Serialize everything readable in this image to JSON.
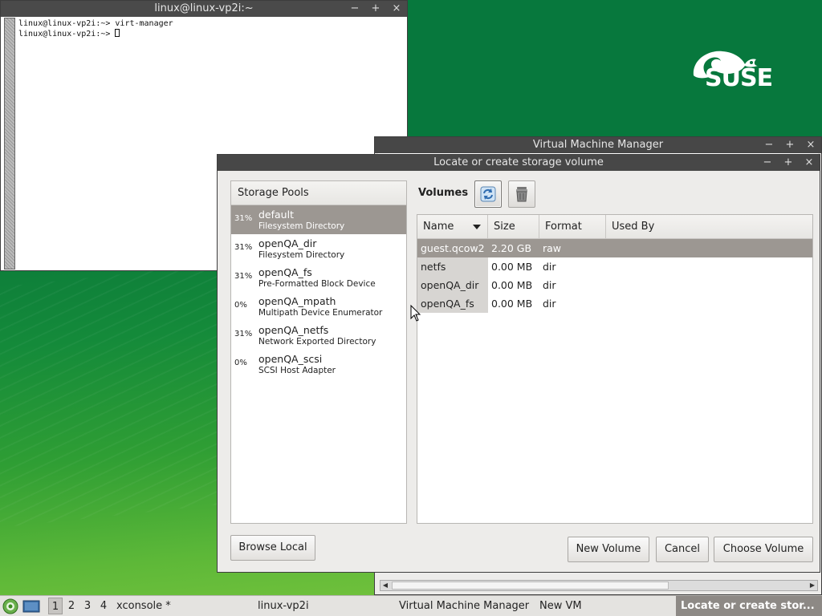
{
  "brand": {
    "logo_text": "SUSE",
    "color_green": "#0b7a3e"
  },
  "terminal": {
    "title": "linux@linux-vp2i:~",
    "line1": "linux@linux-vp2i:~> virt-manager",
    "line2": "linux@linux-vp2i:~> "
  },
  "vmm": {
    "title": "Virtual Machine Manager"
  },
  "dialog": {
    "title": "Locate or create storage volume",
    "pools_header": "Storage Pools",
    "volumes_label": "Volumes",
    "pools": [
      {
        "pct": "31%",
        "name": "default",
        "type": "Filesystem Directory"
      },
      {
        "pct": "31%",
        "name": "openQA_dir",
        "type": "Filesystem Directory"
      },
      {
        "pct": "31%",
        "name": "openQA_fs",
        "type": "Pre-Formatted Block Device"
      },
      {
        "pct": "0%",
        "name": "openQA_mpath",
        "type": "Multipath Device Enumerator"
      },
      {
        "pct": "31%",
        "name": "openQA_netfs",
        "type": "Network Exported Directory"
      },
      {
        "pct": "0%",
        "name": "openQA_scsi",
        "type": "SCSI Host Adapter"
      }
    ],
    "vol_columns": {
      "name": "Name",
      "size": "Size",
      "format": "Format",
      "used_by": "Used By"
    },
    "volumes": [
      {
        "name": "guest.qcow2",
        "size": "2.20 GB",
        "format": "raw",
        "used_by": ""
      },
      {
        "name": "netfs",
        "size": "0.00 MB",
        "format": "dir",
        "used_by": ""
      },
      {
        "name": "openQA_dir",
        "size": "0.00 MB",
        "format": "dir",
        "used_by": ""
      },
      {
        "name": "openQA_fs",
        "size": "0.00 MB",
        "format": "dir",
        "used_by": ""
      }
    ],
    "buttons": {
      "browse": "Browse Local",
      "new_volume": "New Volume",
      "cancel": "Cancel",
      "choose": "Choose Volume"
    }
  },
  "taskbar": {
    "workspaces": [
      "1",
      "2",
      "3",
      "4"
    ],
    "xconsole": "xconsole *",
    "host": "linux-vp2i",
    "task1": "Virtual Machine Manager",
    "task2": "New VM",
    "task3": "Locate or create stor..."
  },
  "window_controls": {
    "minimize": "−",
    "maximize": "+",
    "close": "×"
  }
}
